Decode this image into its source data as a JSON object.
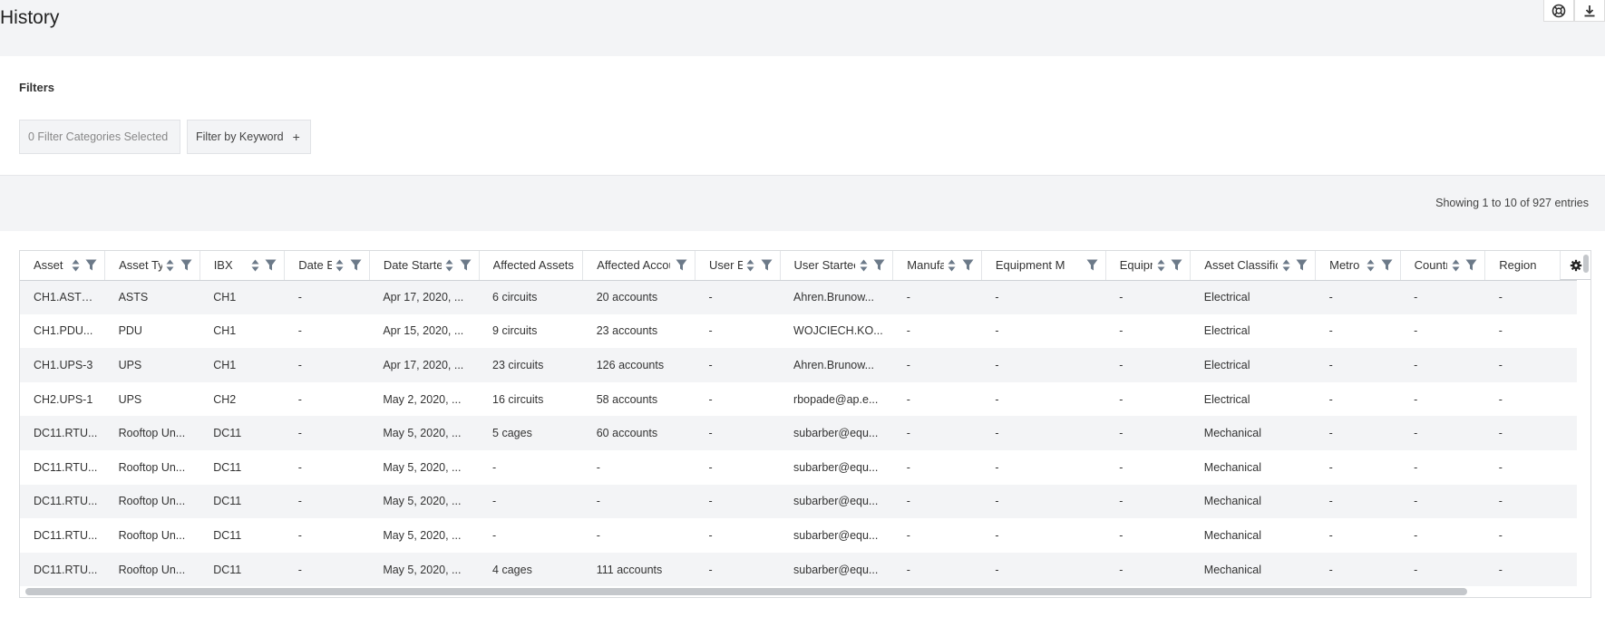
{
  "page": {
    "title": "History"
  },
  "filters": {
    "label": "Filters",
    "categories_button": "0 Filter Categories Selected",
    "keyword_button": "Filter by Keyword",
    "keyword_plus": "+"
  },
  "entries": {
    "text": "Showing 1 to 10 of 927 entries"
  },
  "table": {
    "columns": [
      {
        "label": "Asset",
        "sort": true,
        "filter": true
      },
      {
        "label": "Asset Ty",
        "sort": true,
        "filter": true
      },
      {
        "label": "IBX",
        "sort": true,
        "filter": true
      },
      {
        "label": "Date E",
        "sort": true,
        "filter": true
      },
      {
        "label": "Date Starte",
        "sort": true,
        "filter": true
      },
      {
        "label": "Affected Assets",
        "sort": false,
        "filter": false
      },
      {
        "label": "Affected Accou",
        "sort": false,
        "filter": true
      },
      {
        "label": "User Er",
        "sort": true,
        "filter": true
      },
      {
        "label": "User Startec",
        "sort": true,
        "filter": true
      },
      {
        "label": "Manufa",
        "sort": true,
        "filter": true
      },
      {
        "label": "Equipment M",
        "sort": false,
        "filter": true
      },
      {
        "label": "Equipr",
        "sort": true,
        "filter": true
      },
      {
        "label": "Asset Classific",
        "sort": true,
        "filter": true
      },
      {
        "label": "Metro",
        "sort": true,
        "filter": true
      },
      {
        "label": "Countr",
        "sort": true,
        "filter": true
      },
      {
        "label": "Region",
        "sort": false,
        "filter": false
      }
    ],
    "rows": [
      [
        "CH1.ASTS...",
        "ASTS",
        "CH1",
        "-",
        "Apr 17, 2020, ...",
        "6 circuits",
        "20 accounts",
        "-",
        "Ahren.Brunow...",
        "-",
        "-",
        "-",
        "Electrical",
        "-",
        "-",
        "-"
      ],
      [
        "CH1.PDU...",
        "PDU",
        "CH1",
        "-",
        "Apr 15, 2020, ...",
        "9 circuits",
        "23 accounts",
        "-",
        "WOJCIECH.KO...",
        "-",
        "-",
        "-",
        "Electrical",
        "-",
        "-",
        "-"
      ],
      [
        "CH1.UPS-3",
        "UPS",
        "CH1",
        "-",
        "Apr 17, 2020, ...",
        "23 circuits",
        "126 accounts",
        "-",
        "Ahren.Brunow...",
        "-",
        "-",
        "-",
        "Electrical",
        "-",
        "-",
        "-"
      ],
      [
        "CH2.UPS-1",
        "UPS",
        "CH2",
        "-",
        "May 2, 2020, ...",
        "16 circuits",
        "58 accounts",
        "-",
        "rbopade@ap.e...",
        "-",
        "-",
        "-",
        "Electrical",
        "-",
        "-",
        "-"
      ],
      [
        "DC11.RTU...",
        "Rooftop Un...",
        "DC11",
        "-",
        "May 5, 2020, ...",
        "5 cages",
        "60 accounts",
        "-",
        "subarber@equ...",
        "-",
        "-",
        "-",
        "Mechanical",
        "-",
        "-",
        "-"
      ],
      [
        "DC11.RTU...",
        "Rooftop Un...",
        "DC11",
        "-",
        "May 5, 2020, ...",
        "-",
        "-",
        "-",
        "subarber@equ...",
        "-",
        "-",
        "-",
        "Mechanical",
        "-",
        "-",
        "-"
      ],
      [
        "DC11.RTU...",
        "Rooftop Un...",
        "DC11",
        "-",
        "May 5, 2020, ...",
        "-",
        "-",
        "-",
        "subarber@equ...",
        "-",
        "-",
        "-",
        "Mechanical",
        "-",
        "-",
        "-"
      ],
      [
        "DC11.RTU...",
        "Rooftop Un...",
        "DC11",
        "-",
        "May 5, 2020, ...",
        "-",
        "-",
        "-",
        "subarber@equ...",
        "-",
        "-",
        "-",
        "Mechanical",
        "-",
        "-",
        "-"
      ],
      [
        "DC11.RTU...",
        "Rooftop Un...",
        "DC11",
        "-",
        "May 5, 2020, ...",
        "4 cages",
        "111 accounts",
        "-",
        "subarber@equ...",
        "-",
        "-",
        "-",
        "Mechanical",
        "-",
        "-",
        "-"
      ]
    ]
  },
  "icons": {
    "help": "lifebuoy-icon",
    "download": "download-icon",
    "settings": "gear-icon",
    "sort": "sort-icon",
    "filter": "filter-icon"
  },
  "colors": {
    "header_bg": "#f3f4f6",
    "row_stripe": "#f3f4f6",
    "icon": "#6c7a89"
  }
}
